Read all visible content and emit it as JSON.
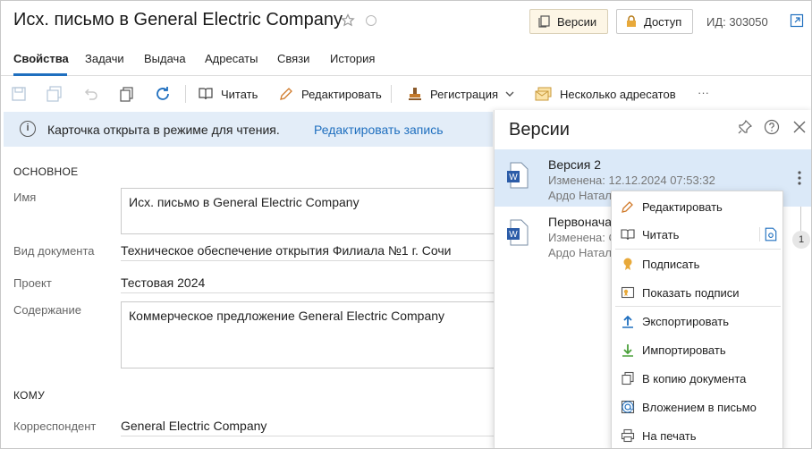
{
  "header": {
    "title": "Исх. письмо в General Electric Company",
    "versions_button": "Версии",
    "access_button": "Доступ",
    "doc_id": "ИД: 303050"
  },
  "tabs": [
    {
      "label": "Свойства",
      "active": true
    },
    {
      "label": "Задачи"
    },
    {
      "label": "Выдача"
    },
    {
      "label": "Адресаты"
    },
    {
      "label": "Связи"
    },
    {
      "label": "История"
    }
  ],
  "toolbar": {
    "read": "Читать",
    "edit": "Редактировать",
    "registration": "Регистрация",
    "multi_addressee": "Несколько адресатов",
    "more": "···"
  },
  "banner": {
    "text": "Карточка открыта в режиме для чтения.",
    "link": "Редактировать запись"
  },
  "form": {
    "section_main": "ОСНОВНОЕ",
    "name_label": "Имя",
    "name_value": "Исх. письмо в General Electric Company",
    "doctype_label": "Вид документа",
    "doctype_value": "Техническое обеспечение открытия Филиала №1 г. Сочи",
    "project_label": "Проект",
    "project_value": "Тестовая 2024",
    "content_label": "Содержание",
    "content_value": "Коммерческое предложение General Electric Company",
    "section_to": "КОМУ",
    "correspondent_label": "Корреспондент",
    "correspondent_value": "General Electric Company"
  },
  "versions_panel": {
    "title": "Версии",
    "items": [
      {
        "name": "Версия 2",
        "changed": "Изменена: 12.12.2024 07:53:32",
        "author": "Ардо Натал"
      },
      {
        "name": "Первонача",
        "changed": "Изменена: С",
        "author": "Ардо Натал"
      }
    ],
    "badge": "1"
  },
  "context_menu": {
    "items": [
      {
        "label": "Редактировать",
        "icon": "pencil-icon"
      },
      {
        "label": "Читать",
        "icon": "book-icon"
      },
      {
        "label": "Подписать",
        "icon": "seal-icon"
      },
      {
        "label": "Показать подписи",
        "icon": "signature-card-icon"
      },
      {
        "label": "Экспортировать",
        "icon": "export-icon"
      },
      {
        "label": "Импортировать",
        "icon": "import-icon"
      },
      {
        "label": "В копию документа",
        "icon": "copy-doc-icon"
      },
      {
        "label": "Вложением в письмо",
        "icon": "email-attach-icon"
      },
      {
        "label": "На печать",
        "icon": "printer-icon"
      }
    ]
  },
  "colors": {
    "accent": "#1f6fbf",
    "banner_bg": "#e3edf8",
    "selected_bg": "#dbe9f8",
    "versions_btn_bg": "#fdf6e6"
  }
}
